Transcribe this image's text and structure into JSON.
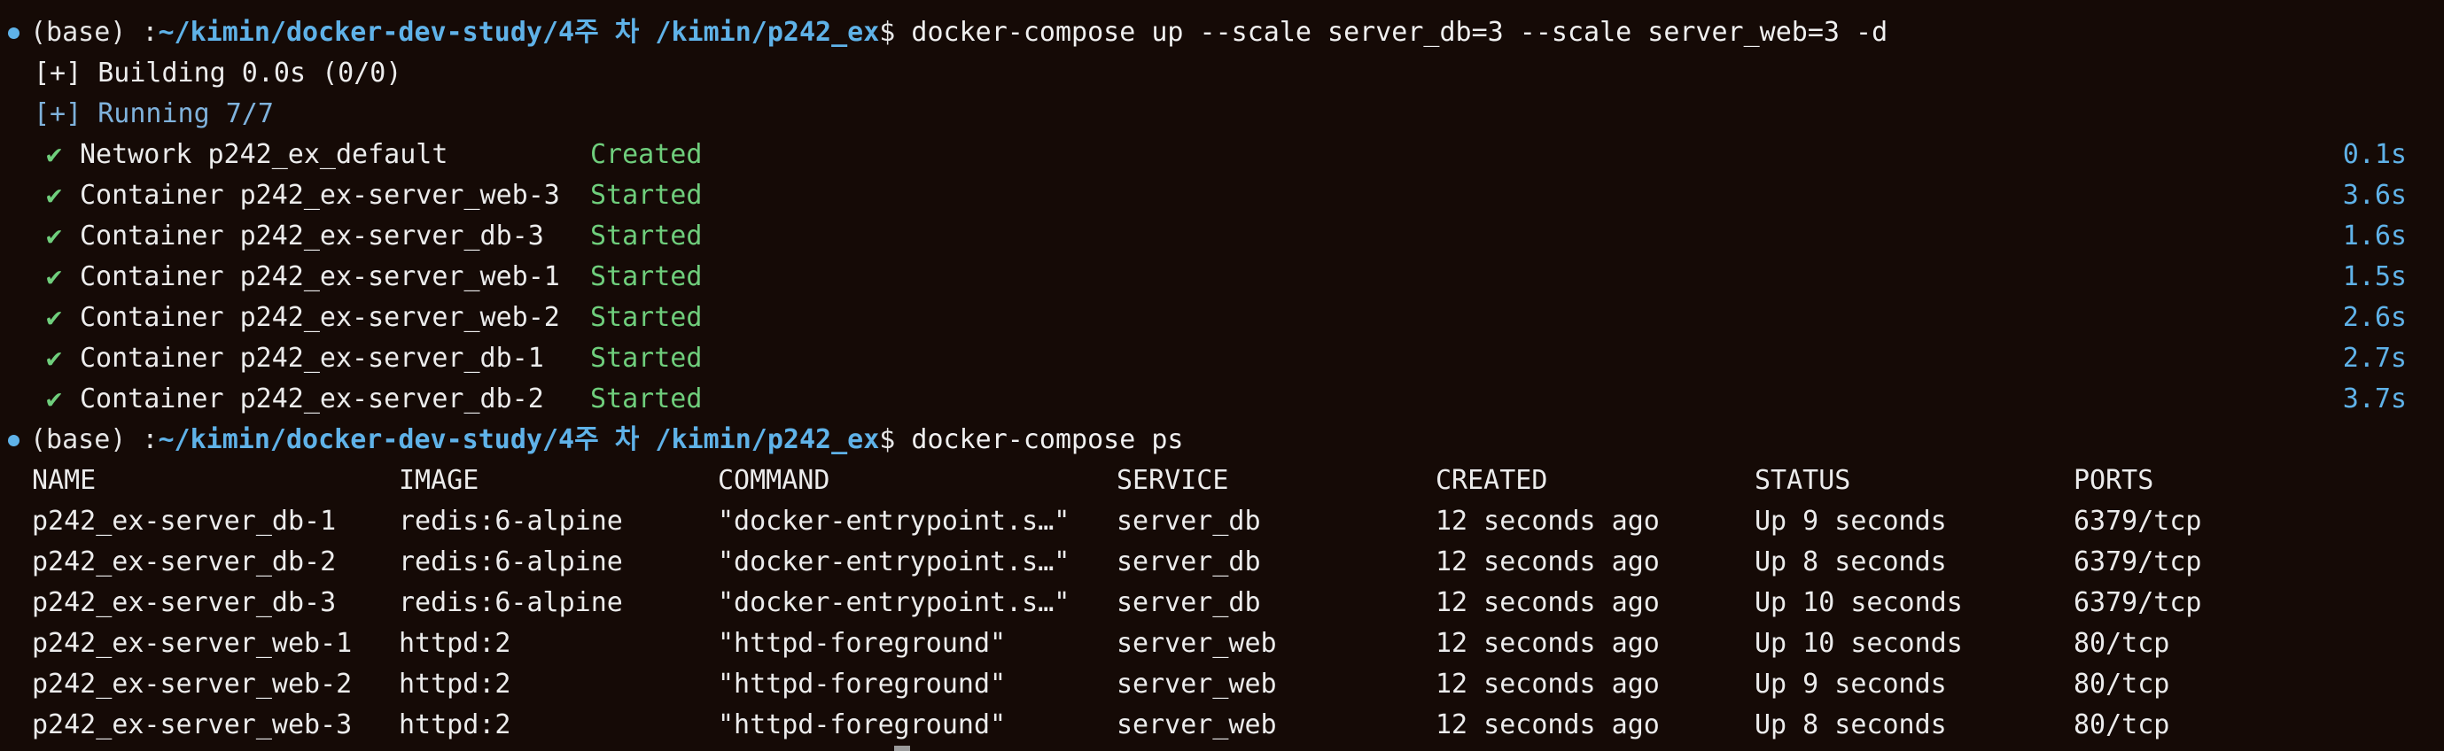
{
  "colors": {
    "background": "#150a06",
    "prompt_dot": "#5fb2e8",
    "path": "#5fb2e8",
    "success": "#6fce7c",
    "timing": "#5fb2e8"
  },
  "prompt1": {
    "env": "(base) :",
    "path": "~/kimin/docker-dev-study/4주 차 /kimin/p242_ex",
    "sym": "$ ",
    "cmd": "docker-compose up --scale server_db=3 --scale server_web=3 -d"
  },
  "building": "[+] Building 0.0s (0/0)",
  "running": "[+] Running 7/7",
  "check_icon": "✔",
  "results": [
    {
      "name": "Network p242_ex_default",
      "status": "Created",
      "time": "0.1s"
    },
    {
      "name": "Container p242_ex-server_web-3",
      "status": "Started",
      "time": "3.6s"
    },
    {
      "name": "Container p242_ex-server_db-3",
      "status": "Started",
      "time": "1.6s"
    },
    {
      "name": "Container p242_ex-server_web-1",
      "status": "Started",
      "time": "1.5s"
    },
    {
      "name": "Container p242_ex-server_web-2",
      "status": "Started",
      "time": "2.6s"
    },
    {
      "name": "Container p242_ex-server_db-1",
      "status": "Started",
      "time": "2.7s"
    },
    {
      "name": "Container p242_ex-server_db-2",
      "status": "Started",
      "time": "3.7s"
    }
  ],
  "prompt2": {
    "env": "(base) :",
    "path": "~/kimin/docker-dev-study/4주 차 /kimin/p242_ex",
    "sym": "$ ",
    "cmd": "docker-compose ps"
  },
  "table": {
    "headers": [
      "NAME",
      "IMAGE",
      "COMMAND",
      "SERVICE",
      "CREATED",
      "STATUS",
      "PORTS"
    ],
    "rows": [
      [
        "p242_ex-server_db-1",
        "redis:6-alpine",
        "\"docker-entrypoint.s…\"",
        "server_db",
        "12 seconds ago",
        "Up 9 seconds",
        "6379/tcp"
      ],
      [
        "p242_ex-server_db-2",
        "redis:6-alpine",
        "\"docker-entrypoint.s…\"",
        "server_db",
        "12 seconds ago",
        "Up 8 seconds",
        "6379/tcp"
      ],
      [
        "p242_ex-server_db-3",
        "redis:6-alpine",
        "\"docker-entrypoint.s…\"",
        "server_db",
        "12 seconds ago",
        "Up 10 seconds",
        "6379/tcp"
      ],
      [
        "p242_ex-server_web-1",
        "httpd:2",
        "\"httpd-foreground\"",
        "server_web",
        "12 seconds ago",
        "Up 10 seconds",
        "80/tcp"
      ],
      [
        "p242_ex-server_web-2",
        "httpd:2",
        "\"httpd-foreground\"",
        "server_web",
        "12 seconds ago",
        "Up 9 seconds",
        "80/tcp"
      ],
      [
        "p242_ex-server_web-3",
        "httpd:2",
        "\"httpd-foreground\"",
        "server_web",
        "12 seconds ago",
        "Up 8 seconds",
        "80/tcp"
      ]
    ]
  }
}
